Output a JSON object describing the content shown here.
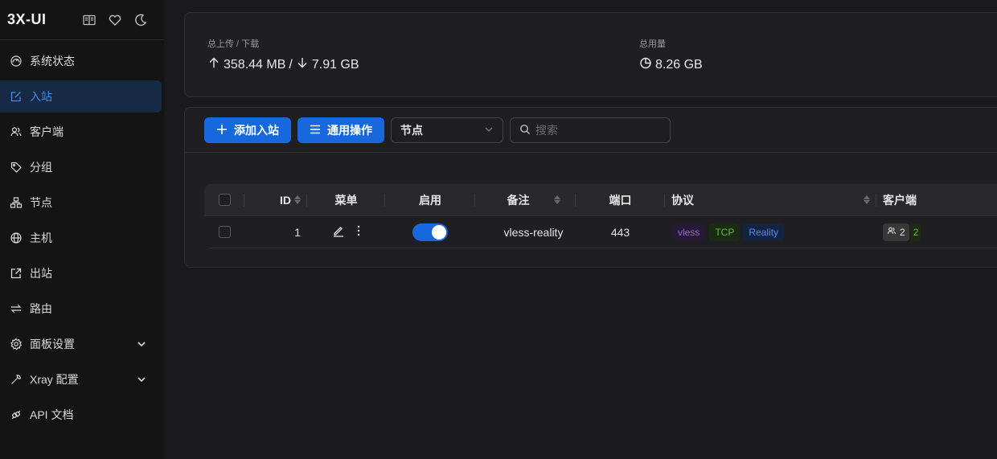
{
  "brand": {
    "title": "3X-UI",
    "icons": [
      "book-icon",
      "heart-icon",
      "moon-icon"
    ]
  },
  "sidebar": {
    "items": [
      {
        "label": "系统状态",
        "icon": "dashboard-icon",
        "active": false
      },
      {
        "label": "入站",
        "icon": "edit-square-icon",
        "active": true
      },
      {
        "label": "客户端",
        "icon": "users-icon",
        "active": false
      },
      {
        "label": "分组",
        "icon": "tag-icon",
        "active": false
      },
      {
        "label": "节点",
        "icon": "cluster-icon",
        "active": false
      },
      {
        "label": "主机",
        "icon": "globe-icon",
        "active": false
      },
      {
        "label": "出站",
        "icon": "export-icon",
        "active": false
      },
      {
        "label": "路由",
        "icon": "swap-icon",
        "active": false
      },
      {
        "label": "面板设置",
        "icon": "gear-icon",
        "active": false,
        "expandable": true
      },
      {
        "label": "Xray 配置",
        "icon": "tool-icon",
        "active": false,
        "expandable": true
      },
      {
        "label": "API 文档",
        "icon": "api-icon",
        "active": false
      }
    ]
  },
  "stats": {
    "traffic_label": "总上传 / 下载",
    "upload": "358.44 MB",
    "separator": "/",
    "download": "7.91 GB",
    "total_label": "总用量",
    "total": "8.26 GB"
  },
  "toolbar": {
    "add_inbound": "添加入站",
    "general_actions": "通用操作",
    "node_select": "节点",
    "search_placeholder": "搜索"
  },
  "table": {
    "headers": {
      "id": "ID",
      "menu": "菜单",
      "enable": "启用",
      "remark": "备注",
      "port": "端口",
      "protocol": "协议",
      "clients": "客户端"
    },
    "rows": [
      {
        "id": "1",
        "enabled": true,
        "remark": "vless-reality",
        "port": "443",
        "protocol_tags": [
          "vless",
          "TCP",
          "Reality"
        ],
        "clients": "2",
        "clients_online": "2"
      }
    ]
  },
  "colors": {
    "accent": "#1668dc",
    "active_nav_bg": "#172a45",
    "active_nav_text": "#3d8bf0",
    "tag_purple": "#9b63d6",
    "tag_green": "#6cb33a",
    "tag_blue": "#4f8ff0"
  }
}
